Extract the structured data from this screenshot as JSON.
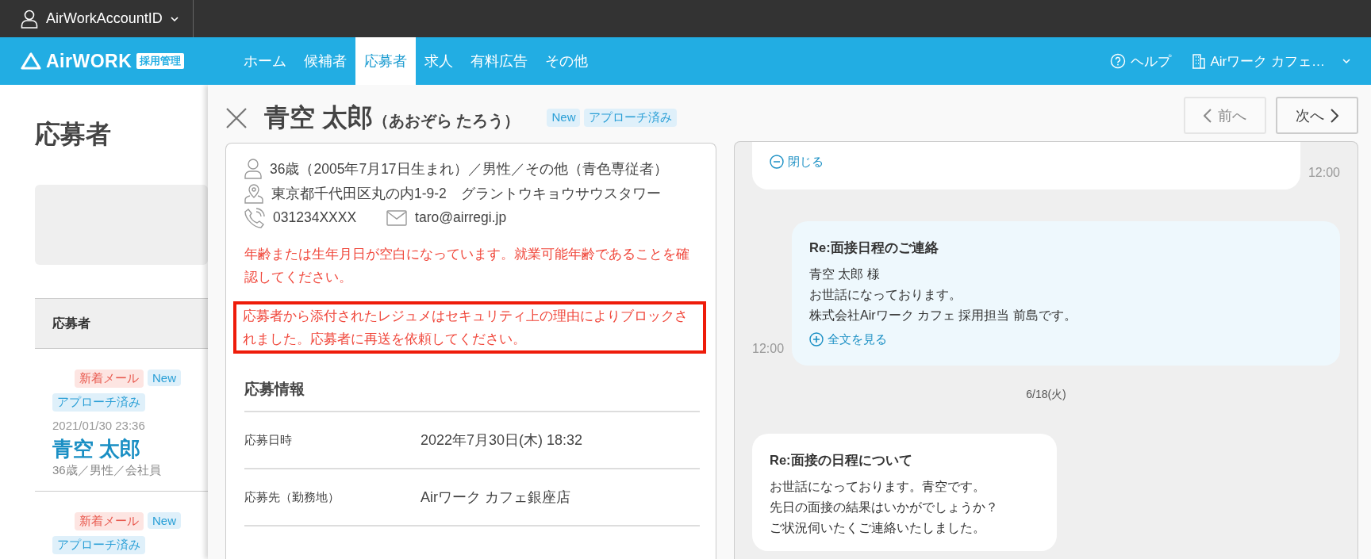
{
  "account": {
    "label": "AirWorkAccountID"
  },
  "header": {
    "logo_text": "AirWORK",
    "logo_badge": "採用管理",
    "nav": [
      {
        "label": "ホーム",
        "selected": false
      },
      {
        "label": "候補者",
        "selected": false
      },
      {
        "label": "応募者",
        "selected": true
      },
      {
        "label": "求人",
        "selected": false
      },
      {
        "label": "有料広告",
        "selected": false
      },
      {
        "label": "その他",
        "selected": false
      }
    ],
    "help": "ヘルプ",
    "store": "Airワーク カフェ…"
  },
  "list_page": {
    "title": "応募者",
    "table_header": "応募者",
    "applicants": [
      {
        "tags": [
          {
            "label": "新着メール",
            "kind": "mail"
          },
          {
            "label": "New",
            "kind": "status"
          },
          {
            "label": "アプローチ済み",
            "kind": "status"
          }
        ],
        "date": "2021/01/30 23:36",
        "name": "青空 太郎",
        "summary": "36歳／男性／会社員"
      },
      {
        "tags": [
          {
            "label": "新着メール",
            "kind": "mail"
          },
          {
            "label": "New",
            "kind": "status"
          },
          {
            "label": "アプローチ済み",
            "kind": "status"
          }
        ]
      }
    ]
  },
  "detail": {
    "name": "青空 太郎",
    "reading": "（あおぞら たろう）",
    "tags": [
      {
        "label": "New",
        "kind": "status"
      },
      {
        "label": "アプローチ済み",
        "kind": "status"
      }
    ],
    "prev": {
      "label": "前へ",
      "disabled": true
    },
    "next": {
      "label": "次へ",
      "disabled": false
    },
    "profile": "36歳（2005年7月17日生まれ）／男性／その他（青色専従者）",
    "address": "東京都千代田区丸の内1-9-2　グラントウキョウサウスタワー",
    "phone": "031234XXXX",
    "email": "taro@airregi.jp",
    "warnings": [
      {
        "text": "年齢または生年月日が空白になっています。就業可能年齢であることを確認してください。",
        "highlighted": false
      },
      {
        "text": "応募者から添付されたレジュメはセキュリティ上の理由によりブロックされました。応募者に再送を依頼してください。",
        "highlighted": true
      }
    ],
    "section_title": "応募情報",
    "fields": [
      {
        "label": "応募日時",
        "value": "2022年7月30日(木) 18:32"
      },
      {
        "label": "応募先（勤務地）",
        "value": "Airワーク カフェ銀座店"
      }
    ]
  },
  "messages": [
    {
      "kind": "received",
      "toggle": {
        "label": "閉じる",
        "expanded": true
      },
      "time": "12:00"
    },
    {
      "kind": "sent",
      "subject": "Re:面接日程のご連絡",
      "lines": [
        "青空 太郎 様",
        "お世話になっております。",
        "株式会社Airワーク カフェ 採用担当 前島です。"
      ],
      "toggle": {
        "label": "全文を見る",
        "expanded": false
      },
      "time": "12:00"
    },
    {
      "kind": "date",
      "text": "6/18(火)"
    },
    {
      "kind": "received",
      "subject": "Re:面接の日程について",
      "lines": [
        "お世話になっております。青空です。",
        "先日の面接の結果はいかがでしょうか？",
        "ご状況伺いたくご連絡いたしました。"
      ]
    }
  ]
}
